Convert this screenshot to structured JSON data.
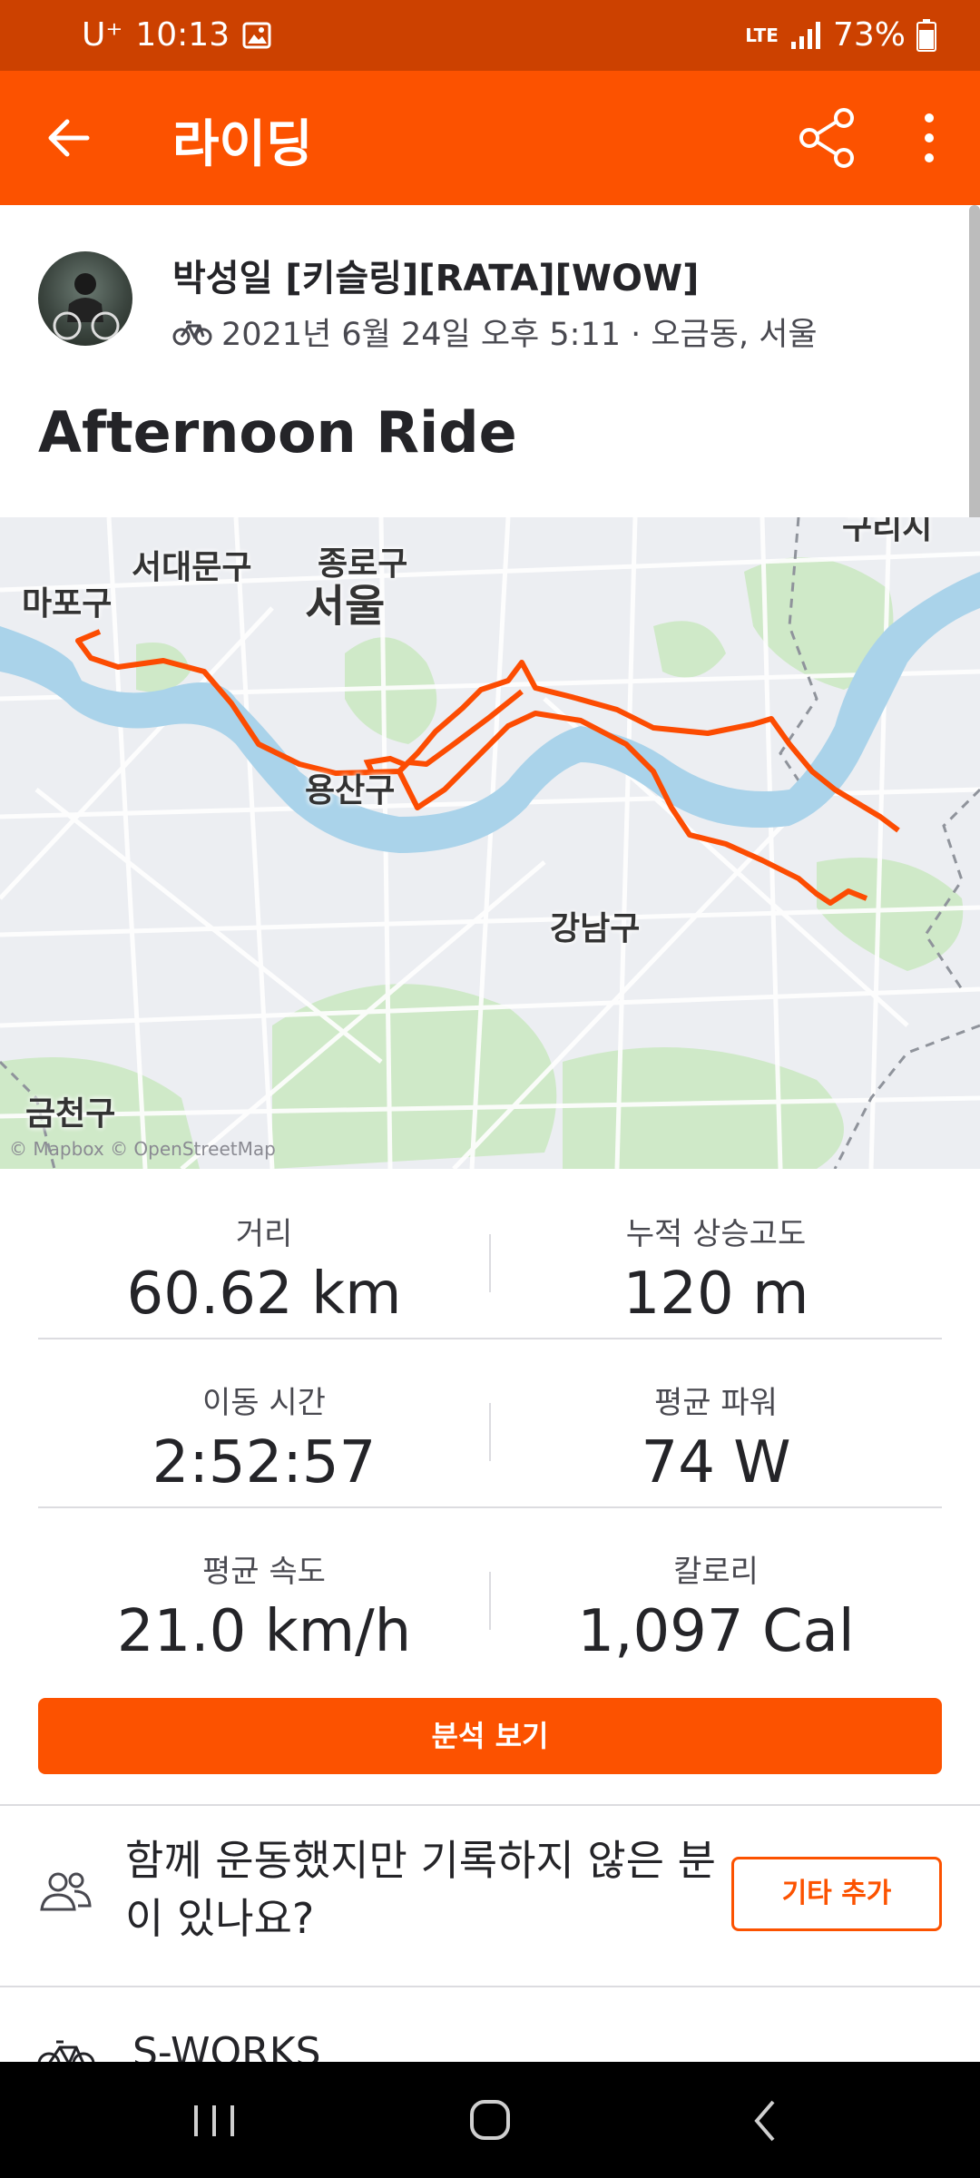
{
  "status_bar": {
    "carrier": "U⁺",
    "time": "10:13",
    "network": "LTE",
    "battery": "73%"
  },
  "app_bar": {
    "title": "라이딩"
  },
  "activity": {
    "athlete_name": "박성일 [키슬링][RATA][WOW]",
    "datetime_location": "2021년 6월 24일 오후 5:11 · 오금동, 서울",
    "title": "Afternoon Ride"
  },
  "map": {
    "labels": {
      "seodaemun": "서대문구",
      "jongno": "종로구",
      "mapo": "마포구",
      "seoul": "서울",
      "yongsan": "용산구",
      "gangnam": "강남구",
      "geumcheon": "금천구",
      "corner": "구리시"
    },
    "attribution": "© Mapbox © OpenStreetMap",
    "colors": {
      "route": "#fc4c02",
      "water": "#aad3ea",
      "park": "#cfe9c8",
      "land": "#eceef2"
    }
  },
  "stats": [
    {
      "label": "거리",
      "value": "60.62 km"
    },
    {
      "label": "누적 상승고도",
      "value": "120 m"
    },
    {
      "label": "이동 시간",
      "value": "2:52:57"
    },
    {
      "label": "평균 파워",
      "value": "74 W"
    },
    {
      "label": "평균 속도",
      "value": "21.0 km/h"
    },
    {
      "label": "칼로리",
      "value": "1,097 Cal"
    }
  ],
  "analyze_button": "분석 보기",
  "group_prompt": {
    "text": "함께 운동했지만 기록하지 않은 분이 있나요?",
    "button": "기타 추가"
  },
  "gear": {
    "name": "S-WORKS"
  },
  "brand_color": "#fc5200"
}
